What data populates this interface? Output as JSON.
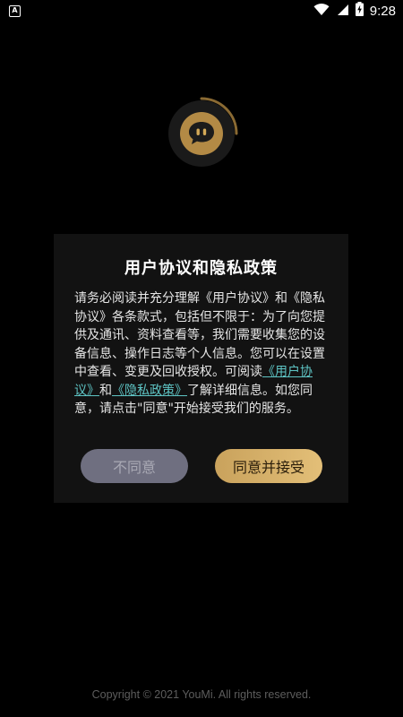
{
  "status_bar": {
    "app_badge": "A",
    "time": "9:28",
    "battery_icon": "battery-charging-icon",
    "wifi_icon": "wifi-icon",
    "signal_icon": "cellular-signal-icon"
  },
  "logo": {
    "icon": "chat-bubble-icon",
    "accent_color": "#c49a4c"
  },
  "dialog": {
    "title": "用户协议和隐私政策",
    "body_part1": "请务必阅读并充分理解《用户协议》和《隐私协议》各条款式，包括但不限于：为了向您提供及通讯、资料查看等，我们需要收集您的设备信息、操作日志等个人信息。您可以在设置中查看、变更及回收授权。可阅读",
    "link_user_agreement": "《用户协议》",
    "and_text": "和",
    "link_privacy_policy": "《隐私政策》",
    "body_part2": "了解详细信息。如您同意，请点击\"同意\"开始接受我们的服务。",
    "disagree_label": "不同意",
    "agree_label": "同意并接受",
    "link_color": "#5ec4c4"
  },
  "footer": {
    "copyright": "Copyright © 2021 YouMi. All rights reserved."
  }
}
